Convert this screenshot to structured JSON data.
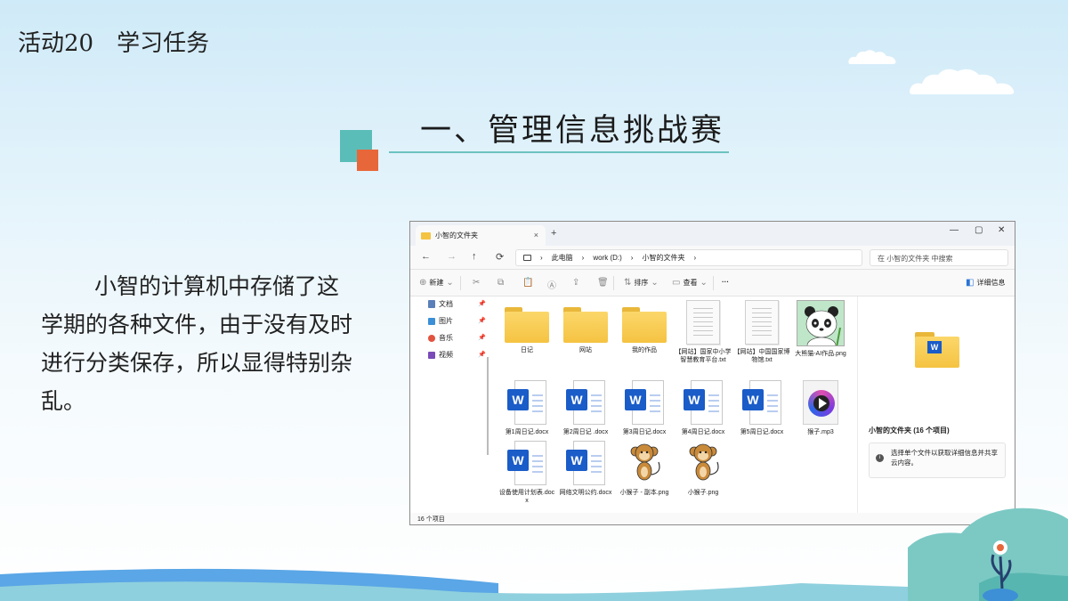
{
  "slide": {
    "title": "活动20　学习任务",
    "heading": "一、管理信息挑战赛",
    "body": "小智的计算机中存储了这学期的各种文件，由于没有及时进行分类保存，所以显得特别杂乱。"
  },
  "window": {
    "tab_title": "小智的文件夹",
    "tab_close": "×",
    "tab_add": "+",
    "controls": [
      "—",
      "▢",
      "✕"
    ],
    "nav": [
      "←",
      "→",
      "↑",
      "⟳"
    ],
    "breadcrumb": [
      "此电脑",
      "work (D:)",
      "小智的文件夹"
    ],
    "breadcrumb_sep": "›",
    "search_placeholder": "在 小智的文件夹 中搜索",
    "toolbar": {
      "new_label": "新建",
      "sort_label": "排序",
      "view_label": "查看",
      "more_label": "···",
      "details_label": "详细信息"
    },
    "sidebar": [
      {
        "label": "文档",
        "icon": "document-icon",
        "color": "#5b7fb8"
      },
      {
        "label": "图片",
        "icon": "picture-icon",
        "color": "#3b8fd6"
      },
      {
        "label": "音乐",
        "icon": "music-icon",
        "color": "#e2533f"
      },
      {
        "label": "视频",
        "icon": "video-icon",
        "color": "#7a4ab8"
      }
    ],
    "files": [
      {
        "name": "日记",
        "type": "folder"
      },
      {
        "name": "网站",
        "type": "folder"
      },
      {
        "name": "我的作品",
        "type": "folder"
      },
      {
        "name": "【网站】国家中小学智慧教育平台.txt",
        "type": "txt"
      },
      {
        "name": "【网站】中国国家博物馆.txt",
        "type": "txt"
      },
      {
        "name": "大熊猫-AI作品.png",
        "type": "image"
      },
      {
        "name": "第1周日记.docx",
        "type": "docx"
      },
      {
        "name": "第2周日记 .docx",
        "type": "docx"
      },
      {
        "name": "第3周日记.docx",
        "type": "docx"
      },
      {
        "name": "第4周日记.docx",
        "type": "docx"
      },
      {
        "name": "第5周日记.docx",
        "type": "docx"
      },
      {
        "name": "猴子.mp3",
        "type": "mp3"
      },
      {
        "name": "设备使用计划表.docx",
        "type": "docx"
      },
      {
        "name": "网络文明公约.docx",
        "type": "docx"
      },
      {
        "name": "小猴子 - 副本.png",
        "type": "image"
      },
      {
        "name": "小猴子.png",
        "type": "image"
      }
    ],
    "details": {
      "title": "小智的文件夹 (16 个项目)",
      "info": "选择单个文件以获取详细信息并共享云内容。"
    },
    "status": "16 个项目"
  },
  "colors": {
    "accent_teal": "#5bbdb8",
    "accent_orange": "#e8673a",
    "word_blue": "#1a5cc8",
    "folder_yellow": "#f5c342"
  }
}
